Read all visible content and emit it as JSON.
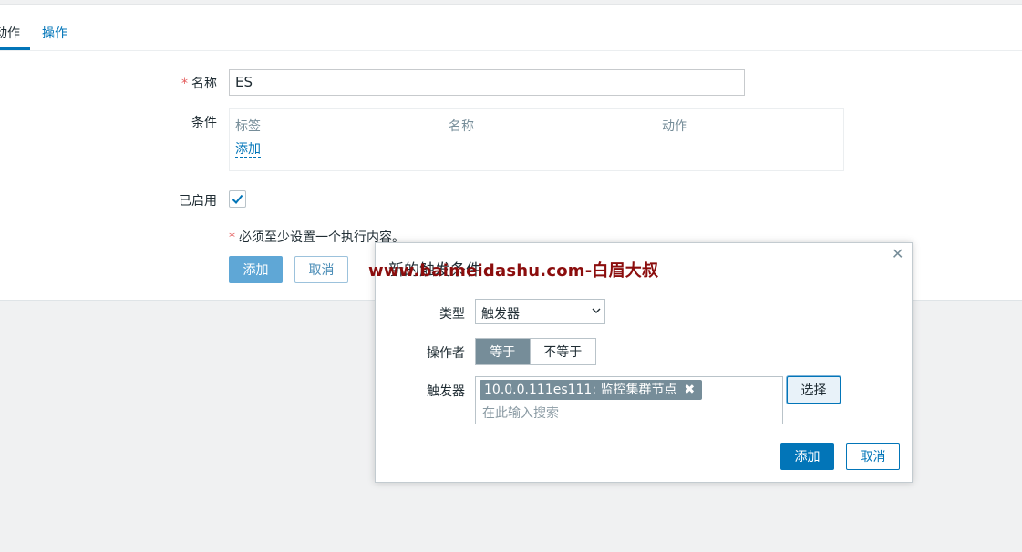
{
  "tabs": [
    {
      "label": "动作",
      "active": true
    },
    {
      "label": "操作",
      "active": false
    }
  ],
  "form": {
    "name_required_mark": "*",
    "name_label": "名称",
    "name_value": "ES",
    "conditions_label": "条件",
    "conditions_columns": [
      "标签",
      "名称",
      "动作"
    ],
    "conditions_add_link": "添加",
    "enabled_label": "已启用",
    "enabled_checked": true,
    "required_note_mark": "*",
    "required_note": "必须至少设置一个执行内容。",
    "add_button": "添加",
    "cancel_button": "取消"
  },
  "dialog": {
    "title": "新的触发条件",
    "close_icon": "close-icon",
    "watermark": "www.baimeidashu.com-白眉大叔",
    "type_label": "类型",
    "type_value": "触发器",
    "operator_label": "操作者",
    "operator_options": [
      "等于",
      "不等于"
    ],
    "operator_selected": "等于",
    "trigger_label": "触发器",
    "trigger_chip": "10.0.0.111es111: 监控集群节点",
    "trigger_placeholder": "在此输入搜索",
    "select_button": "选择",
    "add_button": "添加",
    "cancel_button": "取消"
  },
  "colors": {
    "accent": "#0275b8",
    "required": "#e45959",
    "chip": "#768d99",
    "watermark": "#8b0d0d"
  }
}
